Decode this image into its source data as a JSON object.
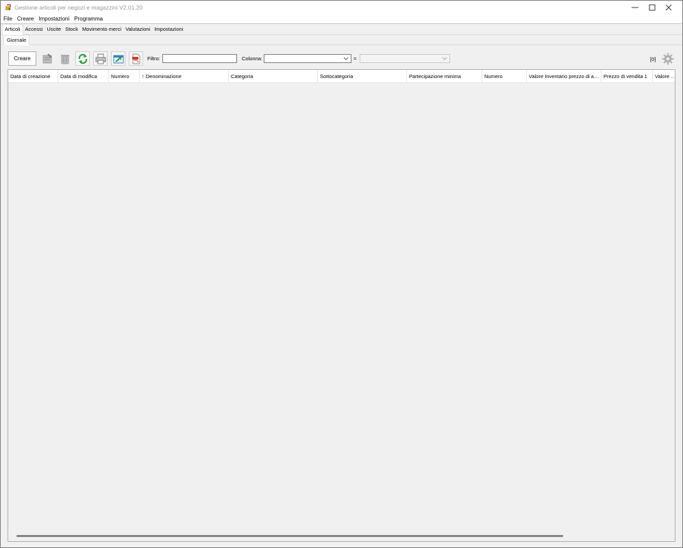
{
  "window": {
    "title": "Gestione articoli per negozi e magazzini V2.01.20"
  },
  "menu": [
    "File",
    "Creare",
    "Impostazioni",
    "Programma"
  ],
  "tabs": [
    "Articoli",
    "Accessi",
    "Uscite",
    "Stock",
    "Movimento merci",
    "Valutazioni",
    "Impostazioni"
  ],
  "active_tab": "Articoli",
  "subtabs": [
    "Giornale"
  ],
  "toolbar": {
    "create_label": "Creare",
    "filter_label": "Filtro:",
    "filter_value": "",
    "column_label": "Colonna:",
    "column_value": "",
    "equals_label": "=",
    "value_value": "",
    "count": "[0]"
  },
  "table": {
    "columns": [
      "Data di creazione",
      "Data di modifica",
      "Numero",
      "Denominazione",
      "Categoria",
      "Sottocategoria",
      "Partecipazione minima",
      "Numero",
      "Valore Inventario prezzo di ac…",
      "Prezzo di vendita 1",
      "Valore Im"
    ],
    "sort_indicator": "↑",
    "rows": []
  },
  "colors": {
    "refresh_green": "#2e9e3a",
    "pdf_red": "#d9332b",
    "window_bg": "#f0f0f0"
  }
}
